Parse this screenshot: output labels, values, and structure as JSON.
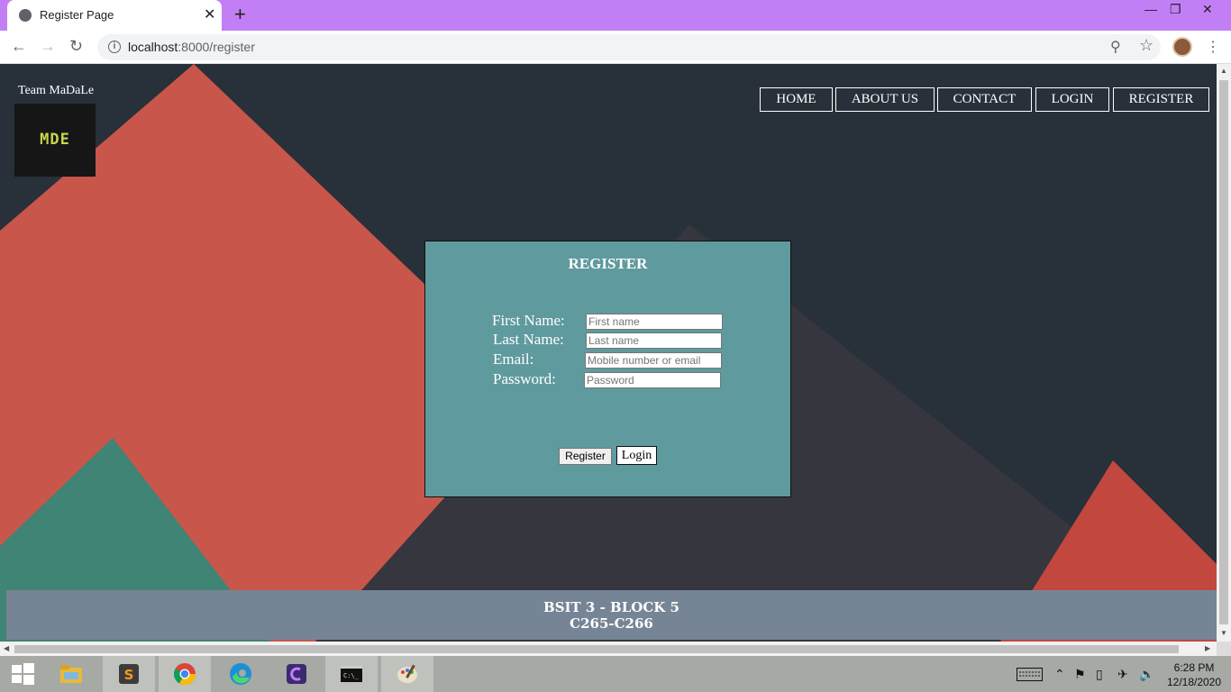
{
  "browser": {
    "tab_title": "Register Page",
    "url_host": "localhost",
    "url_path": ":8000/register",
    "new_tab": "+",
    "tab_close": "✕",
    "minimize": "—",
    "restore": "❐",
    "close": "✕"
  },
  "page": {
    "brand": "Team MaDaLe",
    "logo_text": "MDE",
    "nav": [
      "HOME",
      "ABOUT US",
      "CONTACT",
      "LOGIN",
      "REGISTER"
    ],
    "form": {
      "title": "REGISTER",
      "first_name_label": "First Name:",
      "first_name_placeholder": "First name",
      "last_name_label": "Last Name:",
      "last_name_placeholder": "Last name",
      "email_label": "Email:",
      "email_placeholder": "Mobile number or email",
      "password_label": "Password:",
      "password_placeholder": "Password",
      "register_button": "Register",
      "login_button": "Login"
    },
    "footer": {
      "line1": "BSIT 3 - BLOCK 5",
      "line2": "C265-C266"
    }
  },
  "taskbar": {
    "time": "6:28 PM",
    "date": "12/18/2020"
  },
  "colors": {
    "tabbar": "#c27ff5",
    "panel": "#5f9a9e",
    "footer": "#768595",
    "coral": "#c8564a",
    "teal": "#3f8474"
  }
}
